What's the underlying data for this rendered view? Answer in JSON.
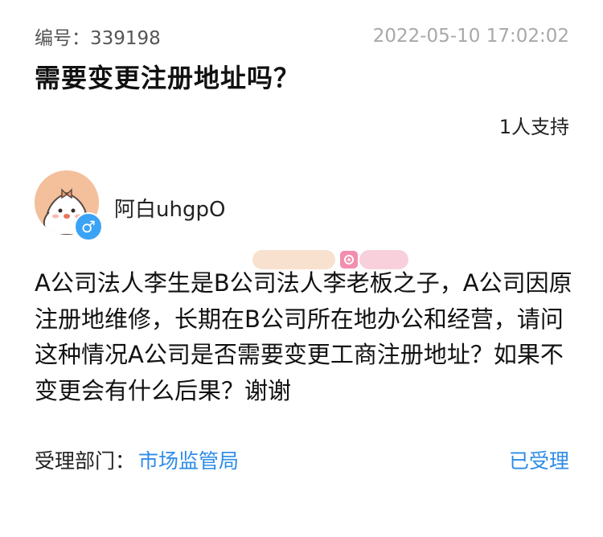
{
  "case": {
    "number_text": "编号：339198",
    "timestamp": "2022-05-10 17:02:02"
  },
  "question": {
    "title": "需要变更注册地址吗？",
    "support_text": "1人支持",
    "body": "A公司法人李生是B公司法人李老板之子，A公司因原注册地维修，长期在B公司所在地办公和经营，请问这种情况A公司是否需要变更工商注册地址？如果不变更会有什么后果？谢谢"
  },
  "user": {
    "name": "阿白uhgpO",
    "gender_symbol": "♂"
  },
  "department": {
    "label": "受理部门：",
    "name": "市场监管局",
    "status": "已受理"
  },
  "colors": {
    "accent": "#2e8ce8",
    "timestamp": "#a8a8a8",
    "gender_badge": "#3ba3f5"
  }
}
